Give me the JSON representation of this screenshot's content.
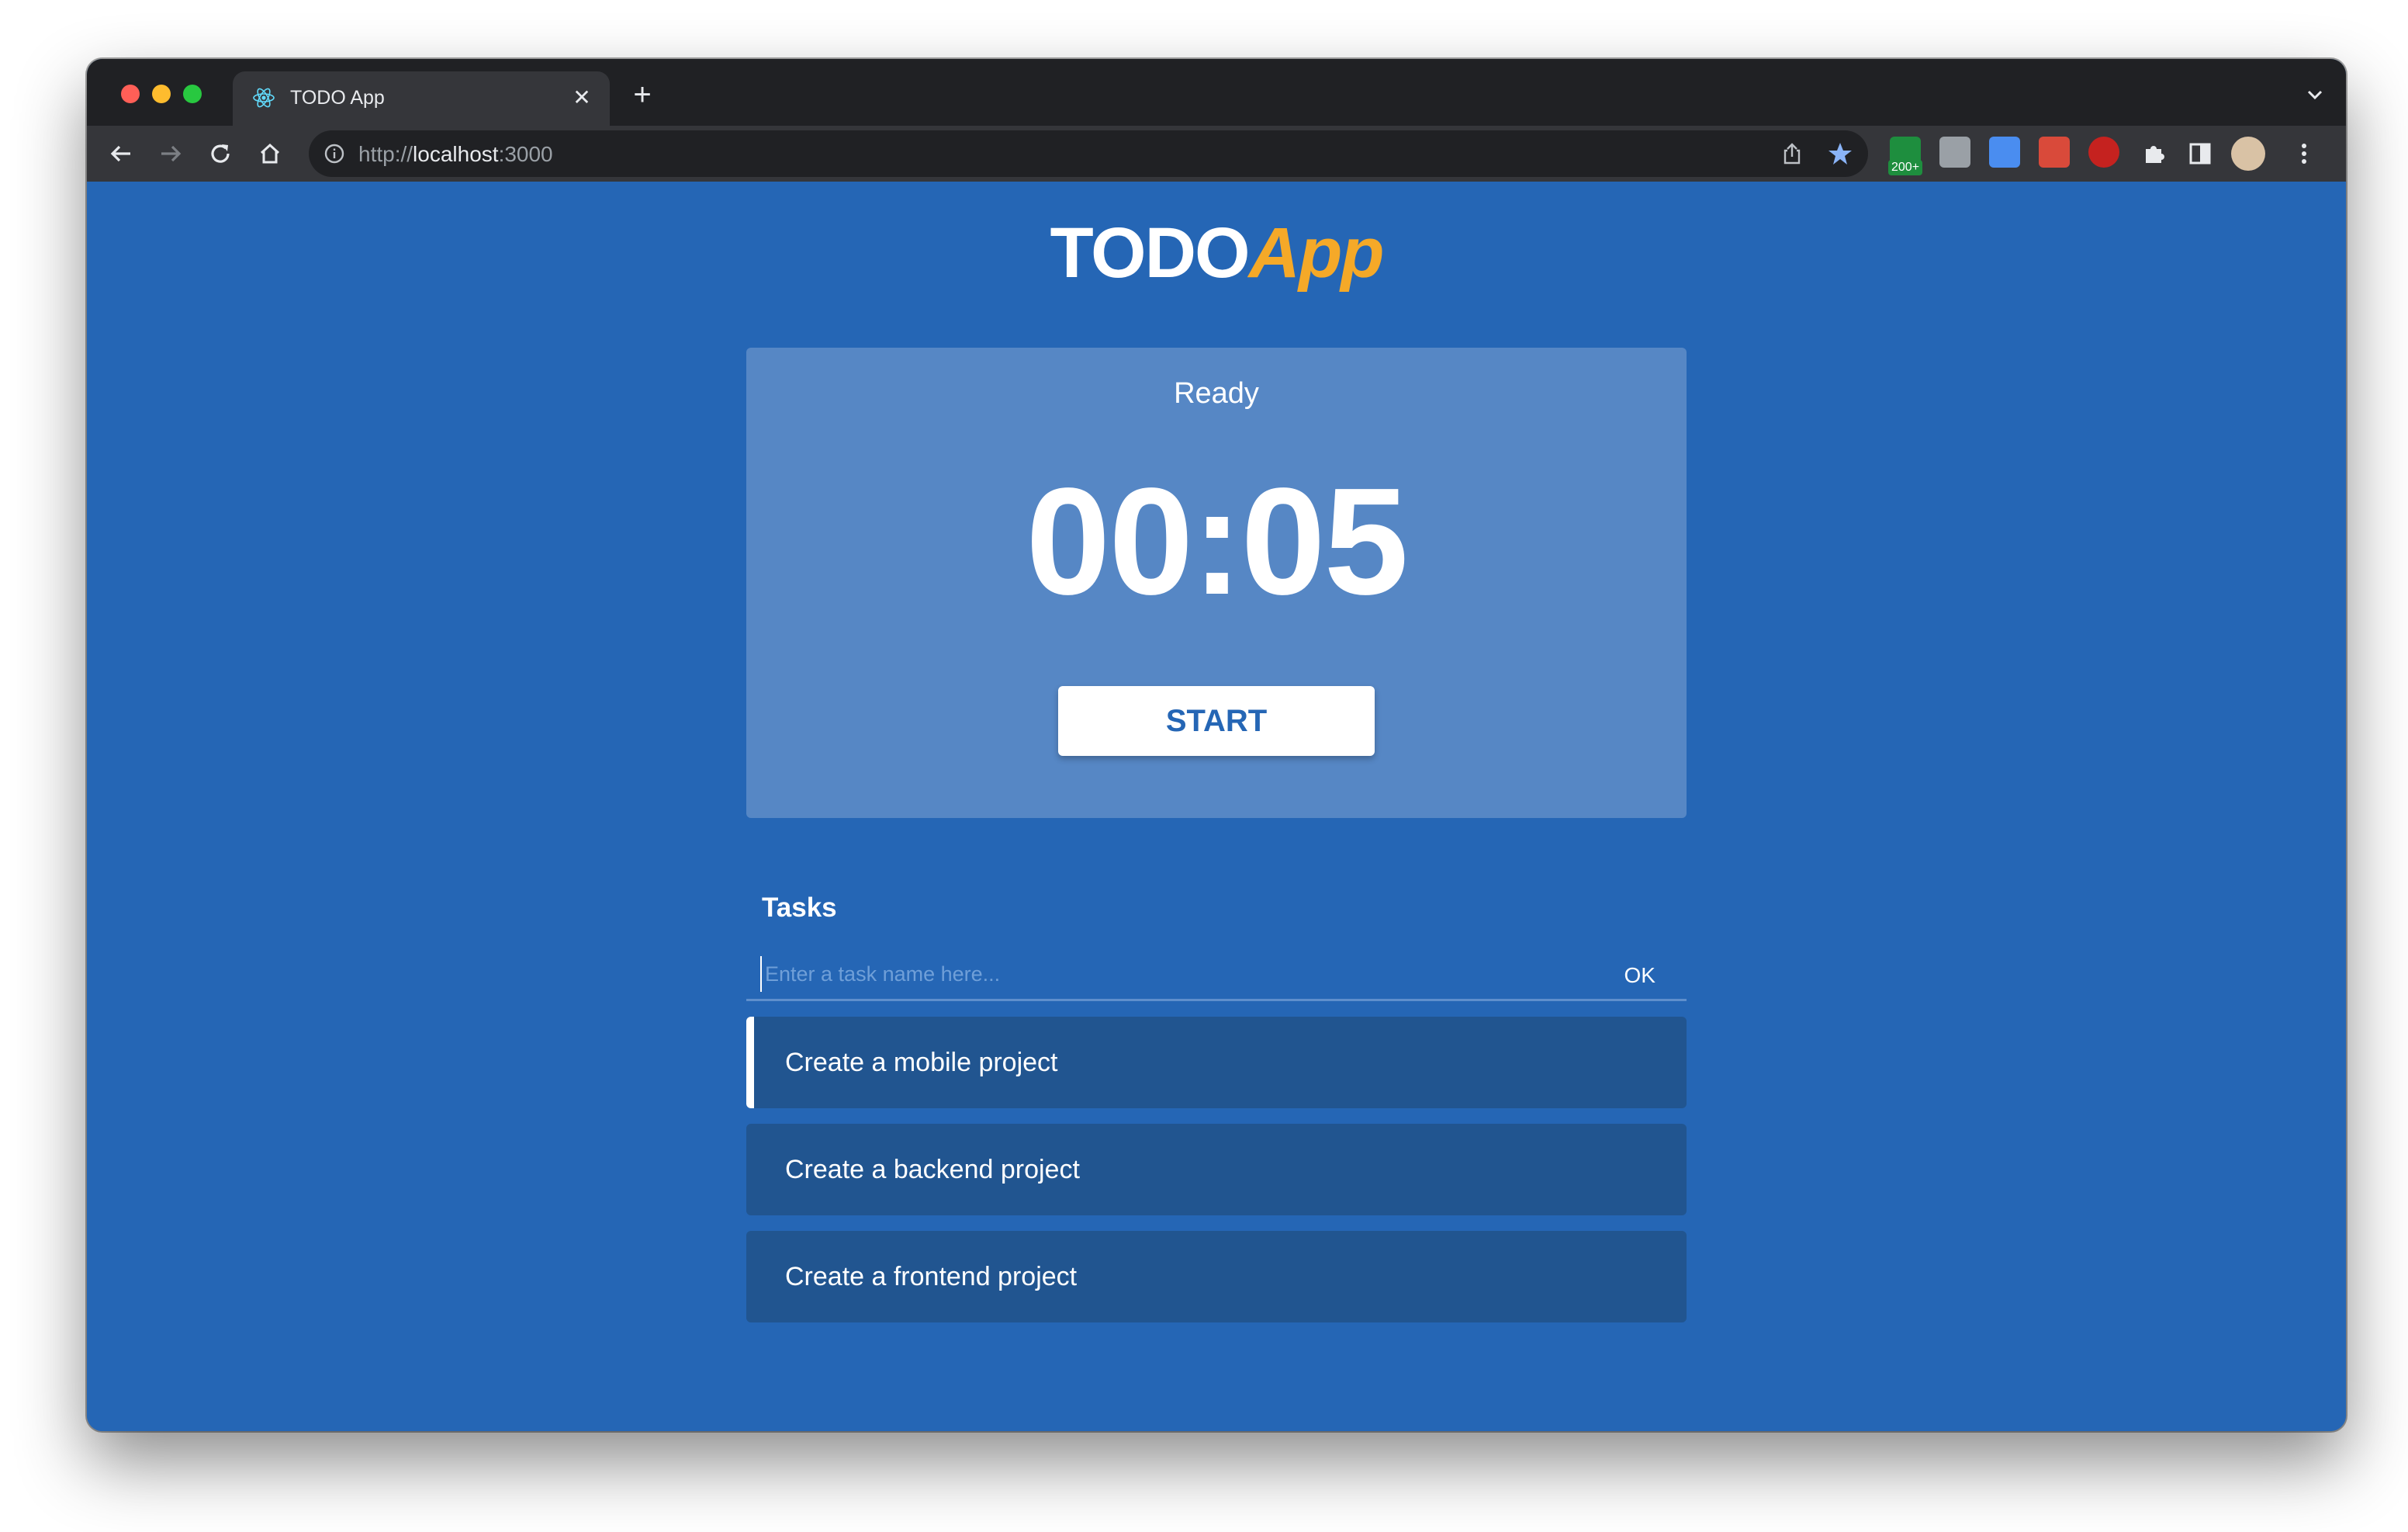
{
  "browser": {
    "tab": {
      "title": "TODO App",
      "favicon": "react-icon"
    },
    "url": {
      "scheme": "http://",
      "host": "localhost",
      "port": ":3000"
    },
    "extensions": [
      {
        "name": "extension-green-icon",
        "badge": "200+"
      },
      {
        "name": "extension-code-icon"
      },
      {
        "name": "extension-blue-icon"
      },
      {
        "name": "extension-red-icon"
      },
      {
        "name": "extension-s-icon"
      }
    ]
  },
  "app": {
    "logo": {
      "part1": "TODO",
      "part2": "App"
    },
    "timer": {
      "status": "Ready",
      "time": "00:05",
      "start_label": "START"
    },
    "tasks": {
      "heading": "Tasks",
      "input_placeholder": "Enter a task name here...",
      "input_value": "",
      "ok_label": "OK",
      "items": [
        {
          "label": "Create a mobile project",
          "selected": true
        },
        {
          "label": "Create a backend project",
          "selected": false
        },
        {
          "label": "Create a frontend project",
          "selected": false
        }
      ]
    }
  },
  "colors": {
    "background": "#2566b5",
    "card": "#5687c5",
    "task_item": "#215590",
    "accent": "#f5a928"
  }
}
